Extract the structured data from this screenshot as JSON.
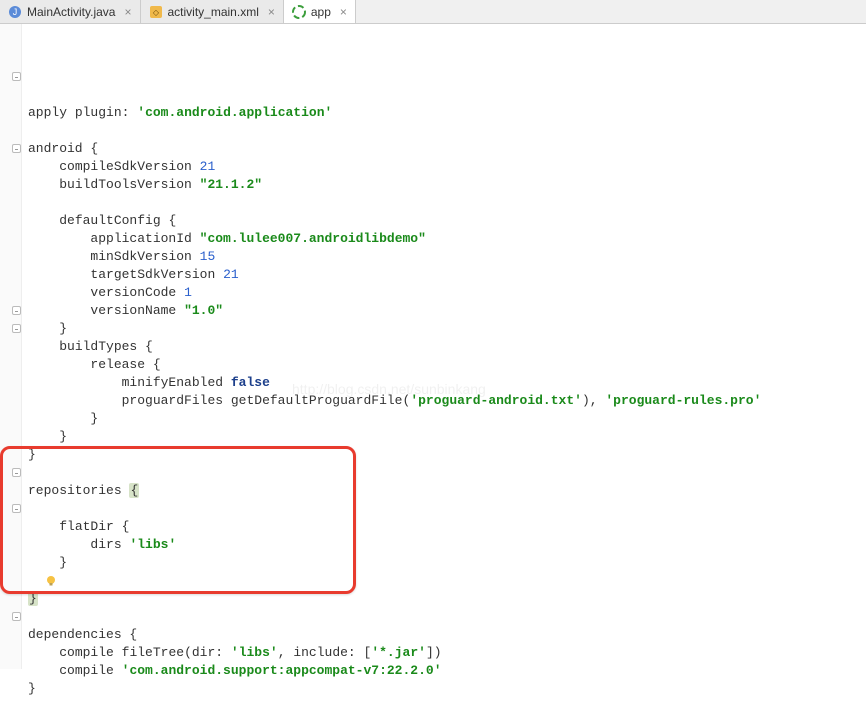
{
  "tabs": [
    {
      "label": "MainActivity.java",
      "icon": "java-icon"
    },
    {
      "label": "activity_main.xml",
      "icon": "xml-icon"
    },
    {
      "label": "app",
      "icon": "gradle-icon"
    }
  ],
  "active_tab": 2,
  "code": {
    "l1": {
      "apply": "apply",
      "plugin": "plugin",
      "colon": ":",
      "val": "'com.android.application'"
    },
    "l2": "android",
    "l3": "compileSdkVersion",
    "l3n": "21",
    "l4": "buildToolsVersion",
    "l4s": "\"21.1.2\"",
    "l5": "defaultConfig",
    "l6": "applicationId",
    "l6s": "\"com.lulee007.androidlibdemo\"",
    "l7": "minSdkVersion",
    "l7n": "15",
    "l8": "targetSdkVersion",
    "l8n": "21",
    "l9": "versionCode",
    "l9n": "1",
    "l10": "versionName",
    "l10s": "\"1.0\"",
    "l11": "buildTypes",
    "l12": "release",
    "l13": "minifyEnabled",
    "l13v": "false",
    "l14": "proguardFiles",
    "l14c": "getDefaultProguardFile",
    "l14s1": "'proguard-android.txt'",
    "l14s2": "'proguard-rules.pro'",
    "l15": "repositories",
    "l16": "flatDir",
    "l17": "dirs",
    "l17s": "'libs'",
    "l18": "dependencies",
    "l19": "compile",
    "l19c": "fileTree",
    "l19k1": "dir",
    "l19s1": "'libs'",
    "l19k2": "include",
    "l19s2": "'*.jar'",
    "l20": "compile",
    "l20s": "'com.android.support:appcompat-v7:22.2.0'"
  },
  "watermark": "http://blog.csdn.net/sunbinkang"
}
